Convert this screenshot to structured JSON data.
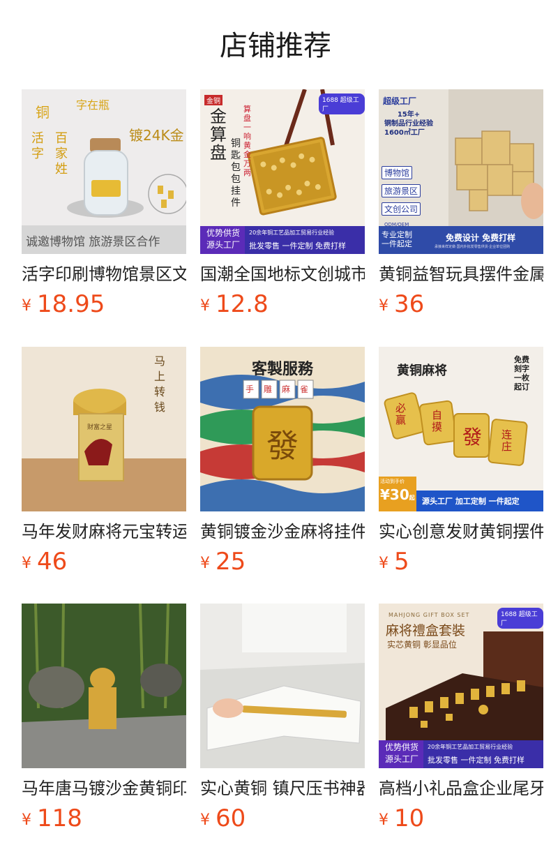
{
  "header": {
    "title": "店铺推荐"
  },
  "colors": {
    "price": "#ee4a1a",
    "title": "#1a1a1a"
  },
  "currency": "¥",
  "products": [
    {
      "name": "活字印刷博物馆景区文创",
      "price": "18.95",
      "image": {
        "corner": "铜",
        "lines": [
          "字在瓶",
          "活字",
          "百家姓",
          "镀24K金"
        ],
        "bottom": "诚邀博物馆 旅游景区合作"
      }
    },
    {
      "name": "国潮全国地标文创城市",
      "price": "12.8",
      "image": {
        "badge": "1688",
        "badge2": "超级工厂",
        "tag": "金铜",
        "vertical1": "金算盘",
        "vertical2": "铜匙包包挂件",
        "vertical3": "算盘一响 黄金万两",
        "banner_left1": "优势供货",
        "banner_left2": "源头工厂",
        "banner_top": "20余年铜工艺品加工贸易行业经验",
        "banner_bottom": "批发零售 一件定制 免费打样"
      }
    },
    {
      "name": "黄铜益智玩具摆件金属",
      "price": "36",
      "image": {
        "logo": "超级工厂",
        "stat1": "15年+",
        "stat2": "铜制品行业经验",
        "stat3": "1600㎡工厂",
        "tag1": "博物馆",
        "tag2": "旅游景区",
        "tag3": "文创公司",
        "oem": "ODM/OEM",
        "custom1": "专业定制",
        "custom2": "一件起定",
        "cta": "免费设计 免费打样",
        "small": "承接来样定做·国内外批发零售供货·企业单位团购"
      }
    },
    {
      "name": "马年发财麻将元宝转运",
      "price": "46",
      "image": {
        "vertical": "马上转钱",
        "label": "财富之星"
      }
    },
    {
      "name": "黄铜镀金沙金麻将挂件",
      "price": "25",
      "image": {
        "title": "客製服務",
        "tiles": [
          "手",
          "雕",
          "麻",
          "雀"
        ],
        "big": "發"
      }
    },
    {
      "name": "实心创意发财黄铜摆件",
      "price": "5",
      "image": {
        "title": "黄铜麻将",
        "side": "免费刻字 一枚起订",
        "tiles": [
          "必赢",
          "自摸",
          "發",
          "连庄"
        ],
        "promo_label": "活动到手价",
        "promo_price": "¥30",
        "promo_unit": "起",
        "banner": "源头工厂 加工定制 一件起定"
      }
    },
    {
      "name": "马年唐马镀沙金黄铜印章",
      "price": "118",
      "image": {}
    },
    {
      "name": "实心黄铜 镇尺压书神器",
      "price": "60",
      "image": {}
    },
    {
      "name": "高档小礼品盒企业尾牙",
      "price": "10",
      "image": {
        "badge": "1688",
        "badge2": "超级工厂",
        "en": "MAHJONG GIFT BOX SET",
        "title": "麻将禮盒套裝",
        "sub": "实芯黄铜 彰显品位",
        "banner_left1": "优势供货",
        "banner_left2": "源头工厂",
        "banner_top": "20余年铜工艺品加工贸易行业经验",
        "banner_bottom": "批发零售 一件定制 免费打样"
      }
    }
  ]
}
